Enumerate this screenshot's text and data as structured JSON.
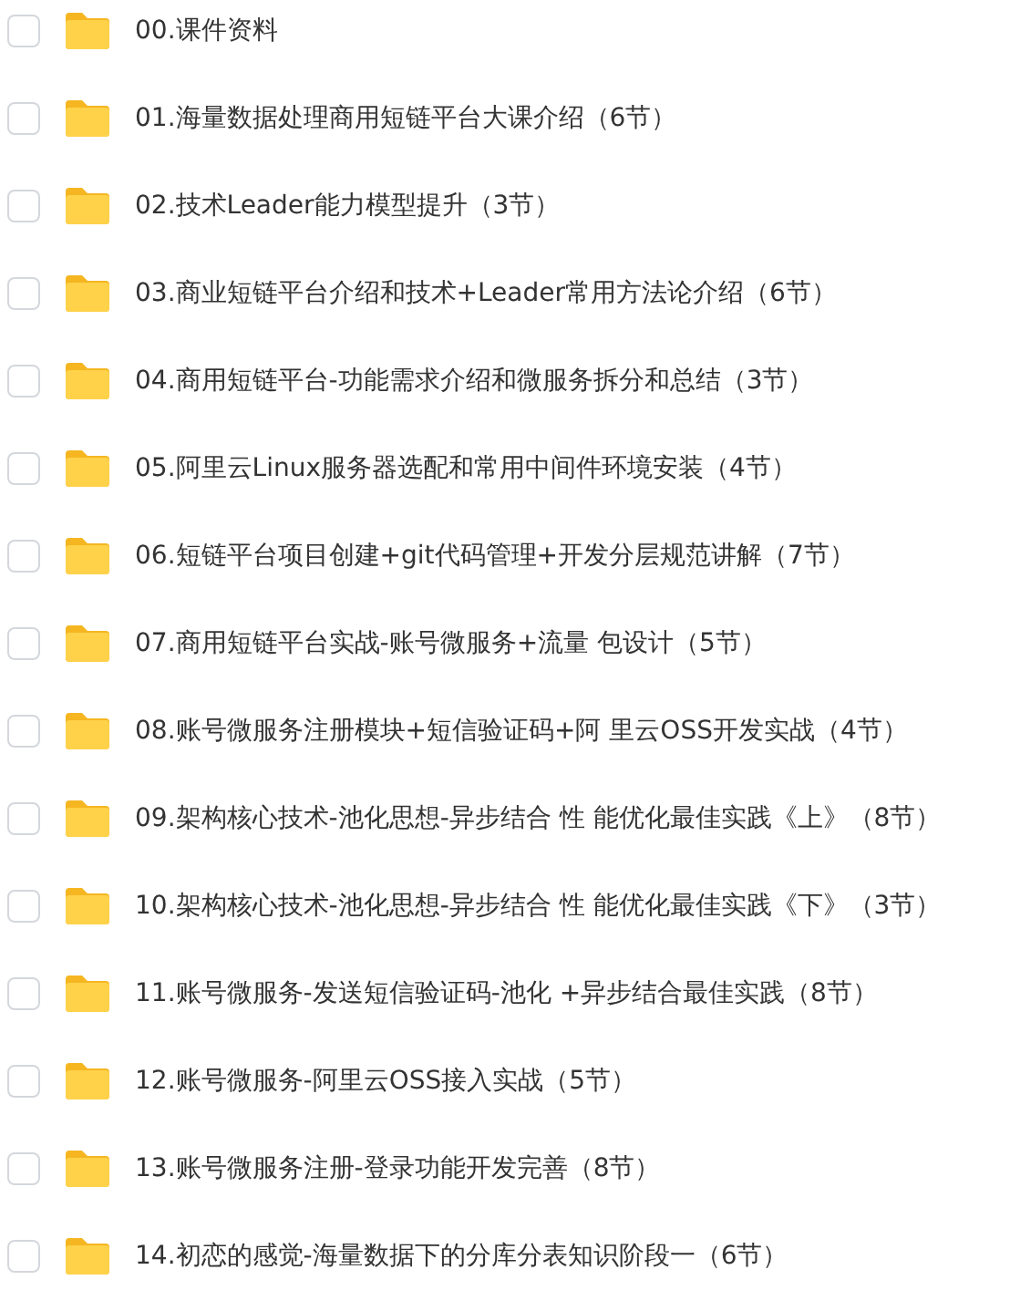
{
  "items": [
    {
      "name": "00.课件资料",
      "checked": false
    },
    {
      "name": "01.海量数据处理商用短链平台大课介绍（6节）",
      "checked": false
    },
    {
      "name": "02.技术Leader能力模型提升（3节）",
      "checked": false
    },
    {
      "name": "03.商业短链平台介绍和技术+Leader常用方法论介绍（6节）",
      "checked": false
    },
    {
      "name": "04.商用短链平台-功能需求介绍和微服务拆分和总结（3节）",
      "checked": false
    },
    {
      "name": "05.阿里云Linux服务器选配和常用中间件环境安装（4节）",
      "checked": false
    },
    {
      "name": "06.短链平台项目创建+git代码管理+开发分层规范讲解（7节）",
      "checked": false
    },
    {
      "name": "07.商用短链平台实战-账号微服务+流量 包设计（5节）",
      "checked": false
    },
    {
      "name": "08.账号微服务注册模块+短信验证码+阿 里云OSS开发实战（4节）",
      "checked": false
    },
    {
      "name": "09.架构核心技术-池化思想-异步结合 性 能优化最佳实践《上》（8节）",
      "checked": false
    },
    {
      "name": "10.架构核心技术-池化思想-异步结合 性 能优化最佳实践《下》（3节）",
      "checked": false
    },
    {
      "name": "11.账号微服务-发送短信验证码-池化 +异步结合最佳实践（8节）",
      "checked": false
    },
    {
      "name": "12.账号微服务-阿里云OSS接入实战（5节）",
      "checked": false
    },
    {
      "name": "13.账号微服务注册-登录功能开发完善（8节）",
      "checked": false
    },
    {
      "name": "14.初恋的感觉-海量数据下的分库分表知识阶段一（6节）",
      "checked": false
    }
  ]
}
